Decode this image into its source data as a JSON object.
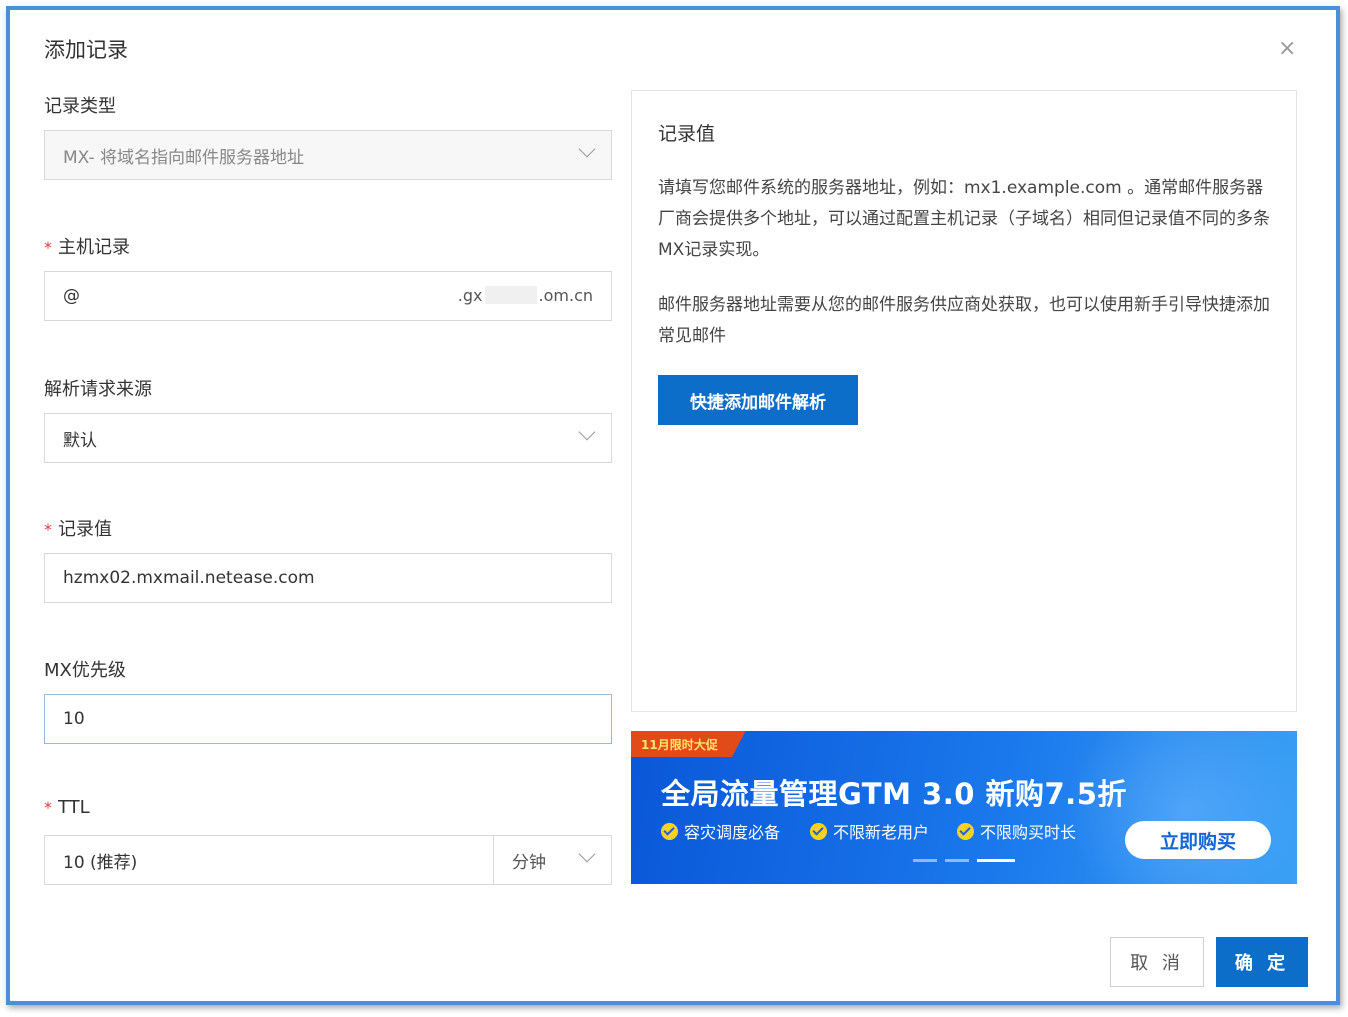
{
  "dialog": {
    "title": "添加记录",
    "close_glyph": "×"
  },
  "form": {
    "record_type": {
      "label": "记录类型",
      "value": "MX- 将域名指向邮件服务器地址"
    },
    "host": {
      "label": "主机记录",
      "required_mark": "*",
      "value": "@",
      "domain_prefix": ".gx",
      "domain_suffix": ".om.cn"
    },
    "source": {
      "label": "解析请求来源",
      "value": "默认"
    },
    "record_value": {
      "label": "记录值",
      "required_mark": "*",
      "value": "hzmx02.mxmail.netease.com"
    },
    "mx_priority": {
      "label": "MX优先级",
      "value": "10"
    },
    "ttl": {
      "label": "TTL",
      "required_mark": "*",
      "value": "10 (推荐)",
      "unit": "分钟"
    }
  },
  "help_panel": {
    "title": "记录值",
    "para1": "请填写您邮件系统的服务器地址，例如：mx1.example.com 。通常邮件服务器厂商会提供多个地址，可以通过配置主机记录（子域名）相同但记录值不同的多条MX记录实现。",
    "para2": "邮件服务器地址需要从您的邮件服务供应商处获取，也可以使用新手引导快捷添加常见邮件",
    "quick_button": "快捷添加邮件解析"
  },
  "banner": {
    "tag": "11月限时大促",
    "title": "全局流量管理GTM 3.0 新购7.5折",
    "features": [
      "容灾调度必备",
      "不限新老用户",
      "不限购买时长"
    ],
    "buy_button": "立即购买",
    "active_slide": 3,
    "slide_count": 3
  },
  "footer": {
    "cancel": "取 消",
    "ok": "确 定"
  },
  "colors": {
    "primary": "#0d6ec9",
    "required": "#e4393c",
    "frame_border": "#4a90d9"
  }
}
